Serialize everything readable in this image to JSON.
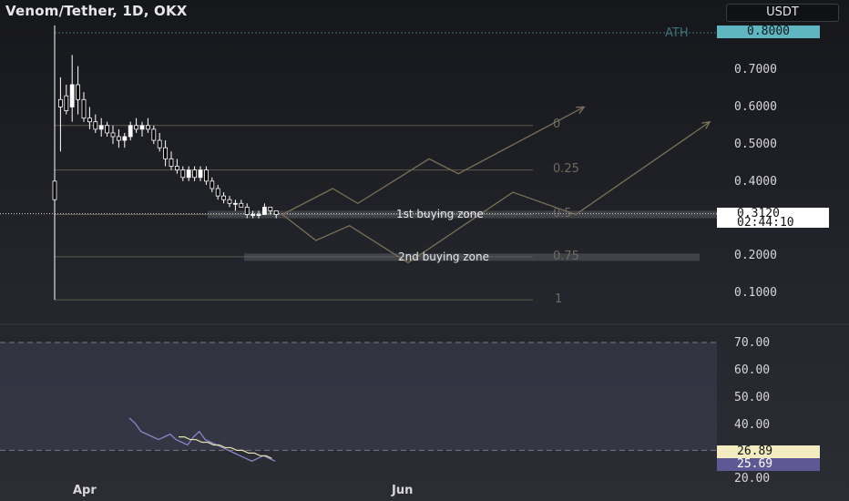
{
  "header": {
    "title": "Venom/Tether, 1D, OKX",
    "currency_button": "USDT"
  },
  "price_axis": {
    "labels": [
      "0.7000",
      "0.6000",
      "0.5000",
      "0.4000",
      "0.2000",
      "0.1000"
    ],
    "ath_label": "ATH",
    "ath_value": "0.8000",
    "current_price": "0.3120",
    "countdown": "02:44:10"
  },
  "fib_levels": [
    "0",
    "0.25",
    "0.5",
    "0.75",
    "1"
  ],
  "zones": {
    "first": "1st buying zone",
    "second": "2nd buying zone"
  },
  "rsi_axis": {
    "labels": [
      "70.00",
      "60.00",
      "50.00",
      "40.00",
      "20.00"
    ],
    "value_a": "26.89",
    "value_b": "25.69"
  },
  "time_axis": [
    "Apr",
    "Jun"
  ],
  "colors": {
    "bg": "#1e1f24",
    "candle": "#ffffff",
    "ath_tag": "#5fb6c1",
    "rsi_line": "#8a84c9",
    "rsi_ma": "#e8e2b0",
    "fib_line": "#5c5a4a",
    "projection": "#7a6f58"
  },
  "chart_data": {
    "type": "candlestick",
    "ylim": [
      0.05,
      0.85
    ],
    "current_price": 0.312,
    "ath": 0.8,
    "candles": [
      {
        "o": 0.4,
        "h": 0.82,
        "l": 0.08,
        "c": 0.35
      },
      {
        "o": 0.62,
        "h": 0.68,
        "l": 0.48,
        "c": 0.6
      },
      {
        "o": 0.63,
        "h": 0.66,
        "l": 0.58,
        "c": 0.59
      },
      {
        "o": 0.6,
        "h": 0.74,
        "l": 0.56,
        "c": 0.66
      },
      {
        "o": 0.66,
        "h": 0.71,
        "l": 0.58,
        "c": 0.62
      },
      {
        "o": 0.62,
        "h": 0.64,
        "l": 0.56,
        "c": 0.57
      },
      {
        "o": 0.57,
        "h": 0.6,
        "l": 0.54,
        "c": 0.56
      },
      {
        "o": 0.56,
        "h": 0.58,
        "l": 0.53,
        "c": 0.54
      },
      {
        "o": 0.54,
        "h": 0.57,
        "l": 0.52,
        "c": 0.55
      },
      {
        "o": 0.55,
        "h": 0.56,
        "l": 0.52,
        "c": 0.53
      },
      {
        "o": 0.53,
        "h": 0.55,
        "l": 0.5,
        "c": 0.52
      },
      {
        "o": 0.52,
        "h": 0.54,
        "l": 0.49,
        "c": 0.51
      },
      {
        "o": 0.51,
        "h": 0.53,
        "l": 0.49,
        "c": 0.52
      },
      {
        "o": 0.52,
        "h": 0.56,
        "l": 0.51,
        "c": 0.55
      },
      {
        "o": 0.55,
        "h": 0.57,
        "l": 0.53,
        "c": 0.54
      },
      {
        "o": 0.54,
        "h": 0.56,
        "l": 0.52,
        "c": 0.55
      },
      {
        "o": 0.55,
        "h": 0.57,
        "l": 0.53,
        "c": 0.54
      },
      {
        "o": 0.54,
        "h": 0.55,
        "l": 0.5,
        "c": 0.51
      },
      {
        "o": 0.51,
        "h": 0.53,
        "l": 0.48,
        "c": 0.49
      },
      {
        "o": 0.49,
        "h": 0.51,
        "l": 0.44,
        "c": 0.46
      },
      {
        "o": 0.46,
        "h": 0.48,
        "l": 0.43,
        "c": 0.44
      },
      {
        "o": 0.44,
        "h": 0.46,
        "l": 0.42,
        "c": 0.43
      },
      {
        "o": 0.43,
        "h": 0.44,
        "l": 0.4,
        "c": 0.41
      },
      {
        "o": 0.41,
        "h": 0.44,
        "l": 0.4,
        "c": 0.43
      },
      {
        "o": 0.43,
        "h": 0.44,
        "l": 0.4,
        "c": 0.41
      },
      {
        "o": 0.41,
        "h": 0.44,
        "l": 0.4,
        "c": 0.43
      },
      {
        "o": 0.43,
        "h": 0.44,
        "l": 0.39,
        "c": 0.4
      },
      {
        "o": 0.4,
        "h": 0.41,
        "l": 0.37,
        "c": 0.38
      },
      {
        "o": 0.38,
        "h": 0.39,
        "l": 0.35,
        "c": 0.36
      },
      {
        "o": 0.36,
        "h": 0.37,
        "l": 0.34,
        "c": 0.35
      },
      {
        "o": 0.35,
        "h": 0.36,
        "l": 0.33,
        "c": 0.34
      },
      {
        "o": 0.34,
        "h": 0.35,
        "l": 0.32,
        "c": 0.34
      },
      {
        "o": 0.34,
        "h": 0.35,
        "l": 0.33,
        "c": 0.33
      },
      {
        "o": 0.33,
        "h": 0.34,
        "l": 0.3,
        "c": 0.31
      },
      {
        "o": 0.31,
        "h": 0.32,
        "l": 0.3,
        "c": 0.31
      },
      {
        "o": 0.31,
        "h": 0.32,
        "l": 0.3,
        "c": 0.31
      },
      {
        "o": 0.31,
        "h": 0.34,
        "l": 0.31,
        "c": 0.33
      },
      {
        "o": 0.33,
        "h": 0.33,
        "l": 0.31,
        "c": 0.32
      },
      {
        "o": 0.32,
        "h": 0.32,
        "l": 0.3,
        "c": 0.31
      }
    ],
    "fib": [
      {
        "label": "0",
        "price": 0.55
      },
      {
        "label": "0.25",
        "price": 0.43
      },
      {
        "label": "0.5",
        "price": 0.31
      },
      {
        "label": "0.75",
        "price": 0.196
      },
      {
        "label": "1",
        "price": 0.08
      }
    ],
    "zones": [
      {
        "label": "1st buying zone",
        "from": 0.3,
        "to": 0.32
      },
      {
        "label": "2nd buying zone",
        "from": 0.185,
        "to": 0.205
      }
    ],
    "projections": [
      [
        [
          0,
          0.31
        ],
        [
          12,
          0.38
        ],
        [
          18,
          0.34
        ],
        [
          35,
          0.46
        ],
        [
          42,
          0.42
        ],
        [
          72,
          0.6
        ]
      ],
      [
        [
          0,
          0.31
        ],
        [
          8,
          0.24
        ],
        [
          16,
          0.28
        ],
        [
          30,
          0.18
        ],
        [
          55,
          0.37
        ],
        [
          70,
          0.31
        ],
        [
          102,
          0.56
        ]
      ]
    ],
    "rsi": {
      "ylim": [
        20,
        72
      ],
      "line": [
        42,
        40,
        37,
        36,
        35,
        34,
        35,
        36,
        34,
        33,
        32,
        35,
        37,
        34,
        33,
        32,
        31,
        30,
        29,
        28,
        27,
        26,
        27,
        28,
        27,
        26
      ],
      "ma": [
        35,
        35,
        34,
        34,
        33,
        33,
        32,
        32,
        31,
        31,
        30,
        30,
        29,
        29,
        28,
        28,
        27
      ],
      "levels": [
        70,
        30
      ]
    }
  }
}
